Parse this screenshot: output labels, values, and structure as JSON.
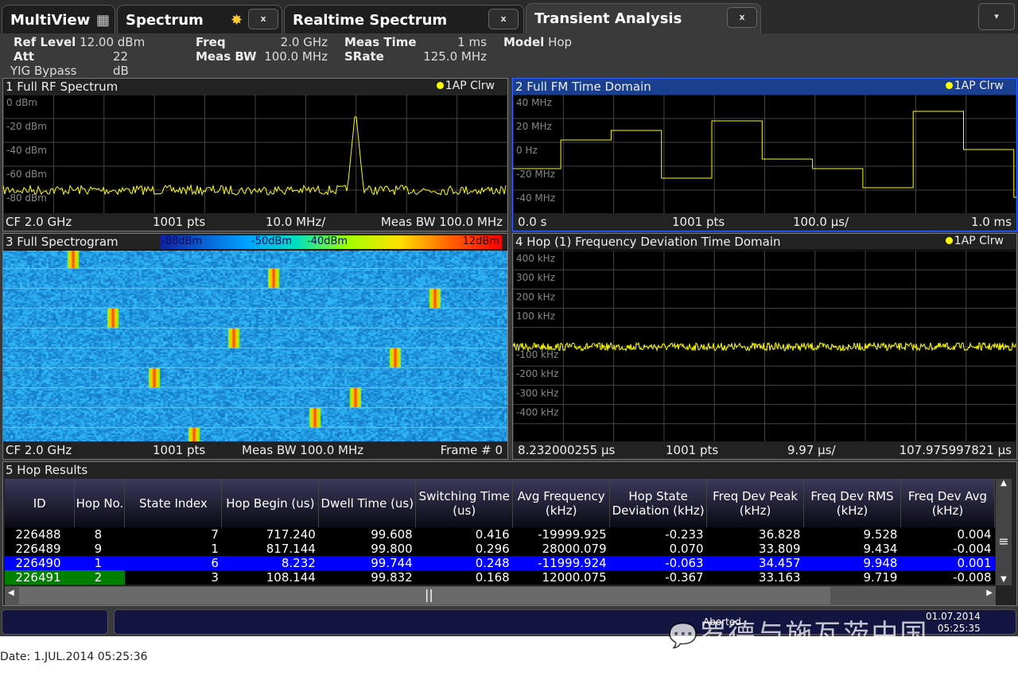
{
  "tabs": [
    {
      "label": "MultiView",
      "icon": "grid-icon"
    },
    {
      "label": "Spectrum",
      "icon": "star-icon",
      "close": "x"
    },
    {
      "label": "Realtime Spectrum",
      "close": "x"
    },
    {
      "label": "Transient Analysis",
      "close": "x",
      "active": true
    }
  ],
  "menu_button": "▾",
  "info": {
    "ref_level_label": "Ref Level",
    "ref_level": "12.00 dBm",
    "att_label": "Att",
    "att": "22 dB",
    "yig": "YIG Bypass",
    "freq_label": "Freq",
    "freq": "2.0 GHz",
    "meas_bw_label": "Meas BW",
    "meas_bw": "100.0 MHz",
    "meas_time_label": "Meas Time",
    "meas_time": "1 ms",
    "srate_label": "SRate",
    "srate": "125.0 MHz",
    "model_label": "Model",
    "model": "Hop"
  },
  "w1": {
    "title": "1 Full RF Spectrum",
    "trace": "1AP Clrw",
    "y_ticks": [
      "0 dBm",
      "-20 dBm",
      "-40 dBm",
      "-60 dBm",
      "-80 dBm"
    ],
    "footer": [
      "CF 2.0 GHz",
      "1001 pts",
      "10.0 MHz/",
      "Meas BW 100.0 MHz"
    ]
  },
  "w2": {
    "title": "2 Full FM Time Domain",
    "trace": "1AP Clrw",
    "y_ticks": [
      "40 MHz",
      "20 MHz",
      "0 Hz",
      "-20 MHz",
      "-40 MHz"
    ],
    "hop_levels_mhz": [
      -12,
      12,
      20,
      -20,
      28,
      -4,
      -12,
      -28,
      36,
      4,
      -36
    ],
    "footer": [
      "0.0 s",
      "1001 pts",
      "100.0 µs/",
      "1.0 ms"
    ]
  },
  "w3": {
    "title": "3 Full Spectrogram",
    "colorbar": [
      "-88dBm",
      "-50dBm",
      "-40dBm",
      "12dBm"
    ],
    "footer": [
      "CF 2.0 GHz",
      "1001 pts",
      "Meas BW 100.0 MHz",
      "Frame # 0"
    ]
  },
  "w4": {
    "title": "4 Hop (1) Frequency Deviation Time Domain",
    "trace": "1AP Clrw",
    "y_ticks": [
      "400 kHz",
      "300 kHz",
      "200 kHz",
      "100 kHz",
      "",
      "-100 kHz",
      "-200 kHz",
      "-300 kHz",
      "-400 kHz"
    ],
    "footer": [
      "8.232000255 µs",
      "1001 pts",
      "9.97 µs/",
      "107.975997821 µs"
    ]
  },
  "w5": {
    "title": "5 Hop Results",
    "columns": [
      "ID",
      "Hop No.",
      "State Index",
      "Hop Begin (us)",
      "Dwell Time (us)",
      "Switching Time (us)",
      "Avg Frequency (kHz)",
      "Hop State Deviation (kHz)",
      "Freq Dev Peak (kHz)",
      "Freq Dev RMS (kHz)",
      "Freq Dev Avg (kHz)"
    ],
    "rows": [
      [
        "226488",
        "8",
        "7",
        "717.240",
        "99.608",
        "0.416",
        "-19999.925",
        "-0.233",
        "36.828",
        "9.528",
        "0.004"
      ],
      [
        "226489",
        "9",
        "1",
        "817.144",
        "99.800",
        "0.296",
        "28000.079",
        "0.070",
        "33.809",
        "9.434",
        "-0.004"
      ],
      [
        "226490",
        "1",
        "6",
        "8.232",
        "99.744",
        "0.248",
        "-11999.924",
        "-0.063",
        "34.457",
        "9.948",
        "0.001"
      ],
      [
        "226491",
        "2",
        "3",
        "108.144",
        "99.832",
        "0.168",
        "12000.075",
        "-0.367",
        "33.163",
        "9.719",
        "-0.008"
      ]
    ],
    "selected_row": 2
  },
  "status": {
    "text": "Aborted",
    "date": "01.07.2014",
    "time": "05:25:35"
  },
  "watermark": "罗德与施瓦茨中国",
  "date_line": "Date: 1.JUL.2014  05:25:36",
  "colors": {
    "trace": "#ffff00",
    "selected": "#0000ff",
    "highlight": "#008000",
    "grid": "#444444"
  }
}
